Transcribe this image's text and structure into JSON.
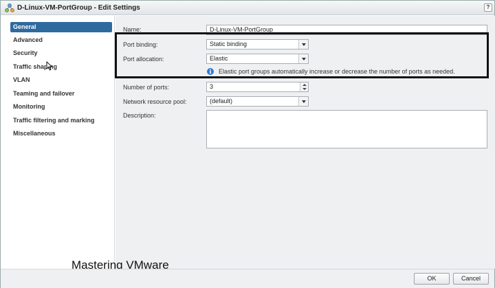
{
  "window": {
    "title": "D-Linux-VM-PortGroup - Edit Settings",
    "help_label": "?"
  },
  "sidebar": {
    "items": [
      {
        "label": "General",
        "selected": true
      },
      {
        "label": "Advanced"
      },
      {
        "label": "Security"
      },
      {
        "label": "Traffic shaping"
      },
      {
        "label": "VLAN"
      },
      {
        "label": "Teaming and failover"
      },
      {
        "label": "Monitoring"
      },
      {
        "label": "Traffic filtering and marking"
      },
      {
        "label": "Miscellaneous"
      }
    ]
  },
  "form": {
    "name_label": "Name:",
    "name_value": "D-Linux-VM-PortGroup",
    "port_binding_label": "Port binding:",
    "port_binding_value": "Static binding",
    "port_allocation_label": "Port allocation:",
    "port_allocation_value": "Elastic",
    "info_text": "Elastic port groups automatically increase or decrease the number of ports as needed.",
    "ports_label": "Number of ports:",
    "ports_value": "3",
    "pool_label": "Network resource pool:",
    "pool_value": "(default)",
    "description_label": "Description:",
    "description_value": ""
  },
  "watermark": "Mastering VMware",
  "footer": {
    "ok_label": "OK",
    "cancel_label": "Cancel"
  },
  "colors": {
    "selected_nav": "#2f6a9e",
    "panel_bg": "#eef0f2",
    "info_icon": "#2d7bd1"
  }
}
